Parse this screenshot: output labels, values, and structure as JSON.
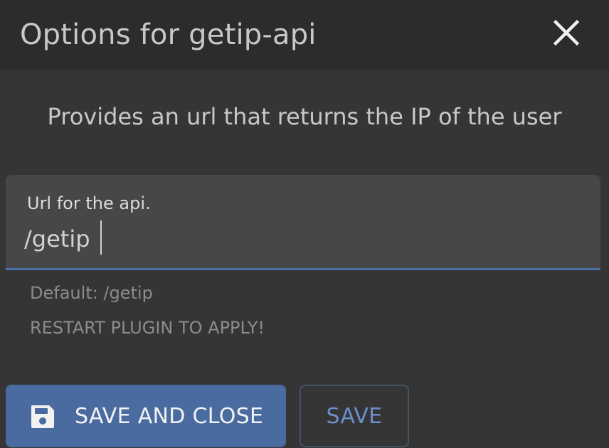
{
  "dialog": {
    "title": "Options for getip-api",
    "close_icon": "close-icon",
    "description": "Provides an url that returns the IP of the user"
  },
  "field": {
    "label": "Url for the api.",
    "value": "/getip",
    "accent_color": "#4a6fa5"
  },
  "hints": {
    "default": "Default: /getip",
    "restart": "RESTART PLUGIN TO APPLY!"
  },
  "buttons": {
    "save_and_close": {
      "label": "SAVE AND CLOSE",
      "icon": "floppy-disk-icon",
      "color": "#4a6ba0"
    },
    "save": {
      "label": "SAVE",
      "color": "#6b8fca"
    }
  },
  "colors": {
    "background": "#353535",
    "header": "#2c2c2c",
    "field_background": "#474747"
  }
}
